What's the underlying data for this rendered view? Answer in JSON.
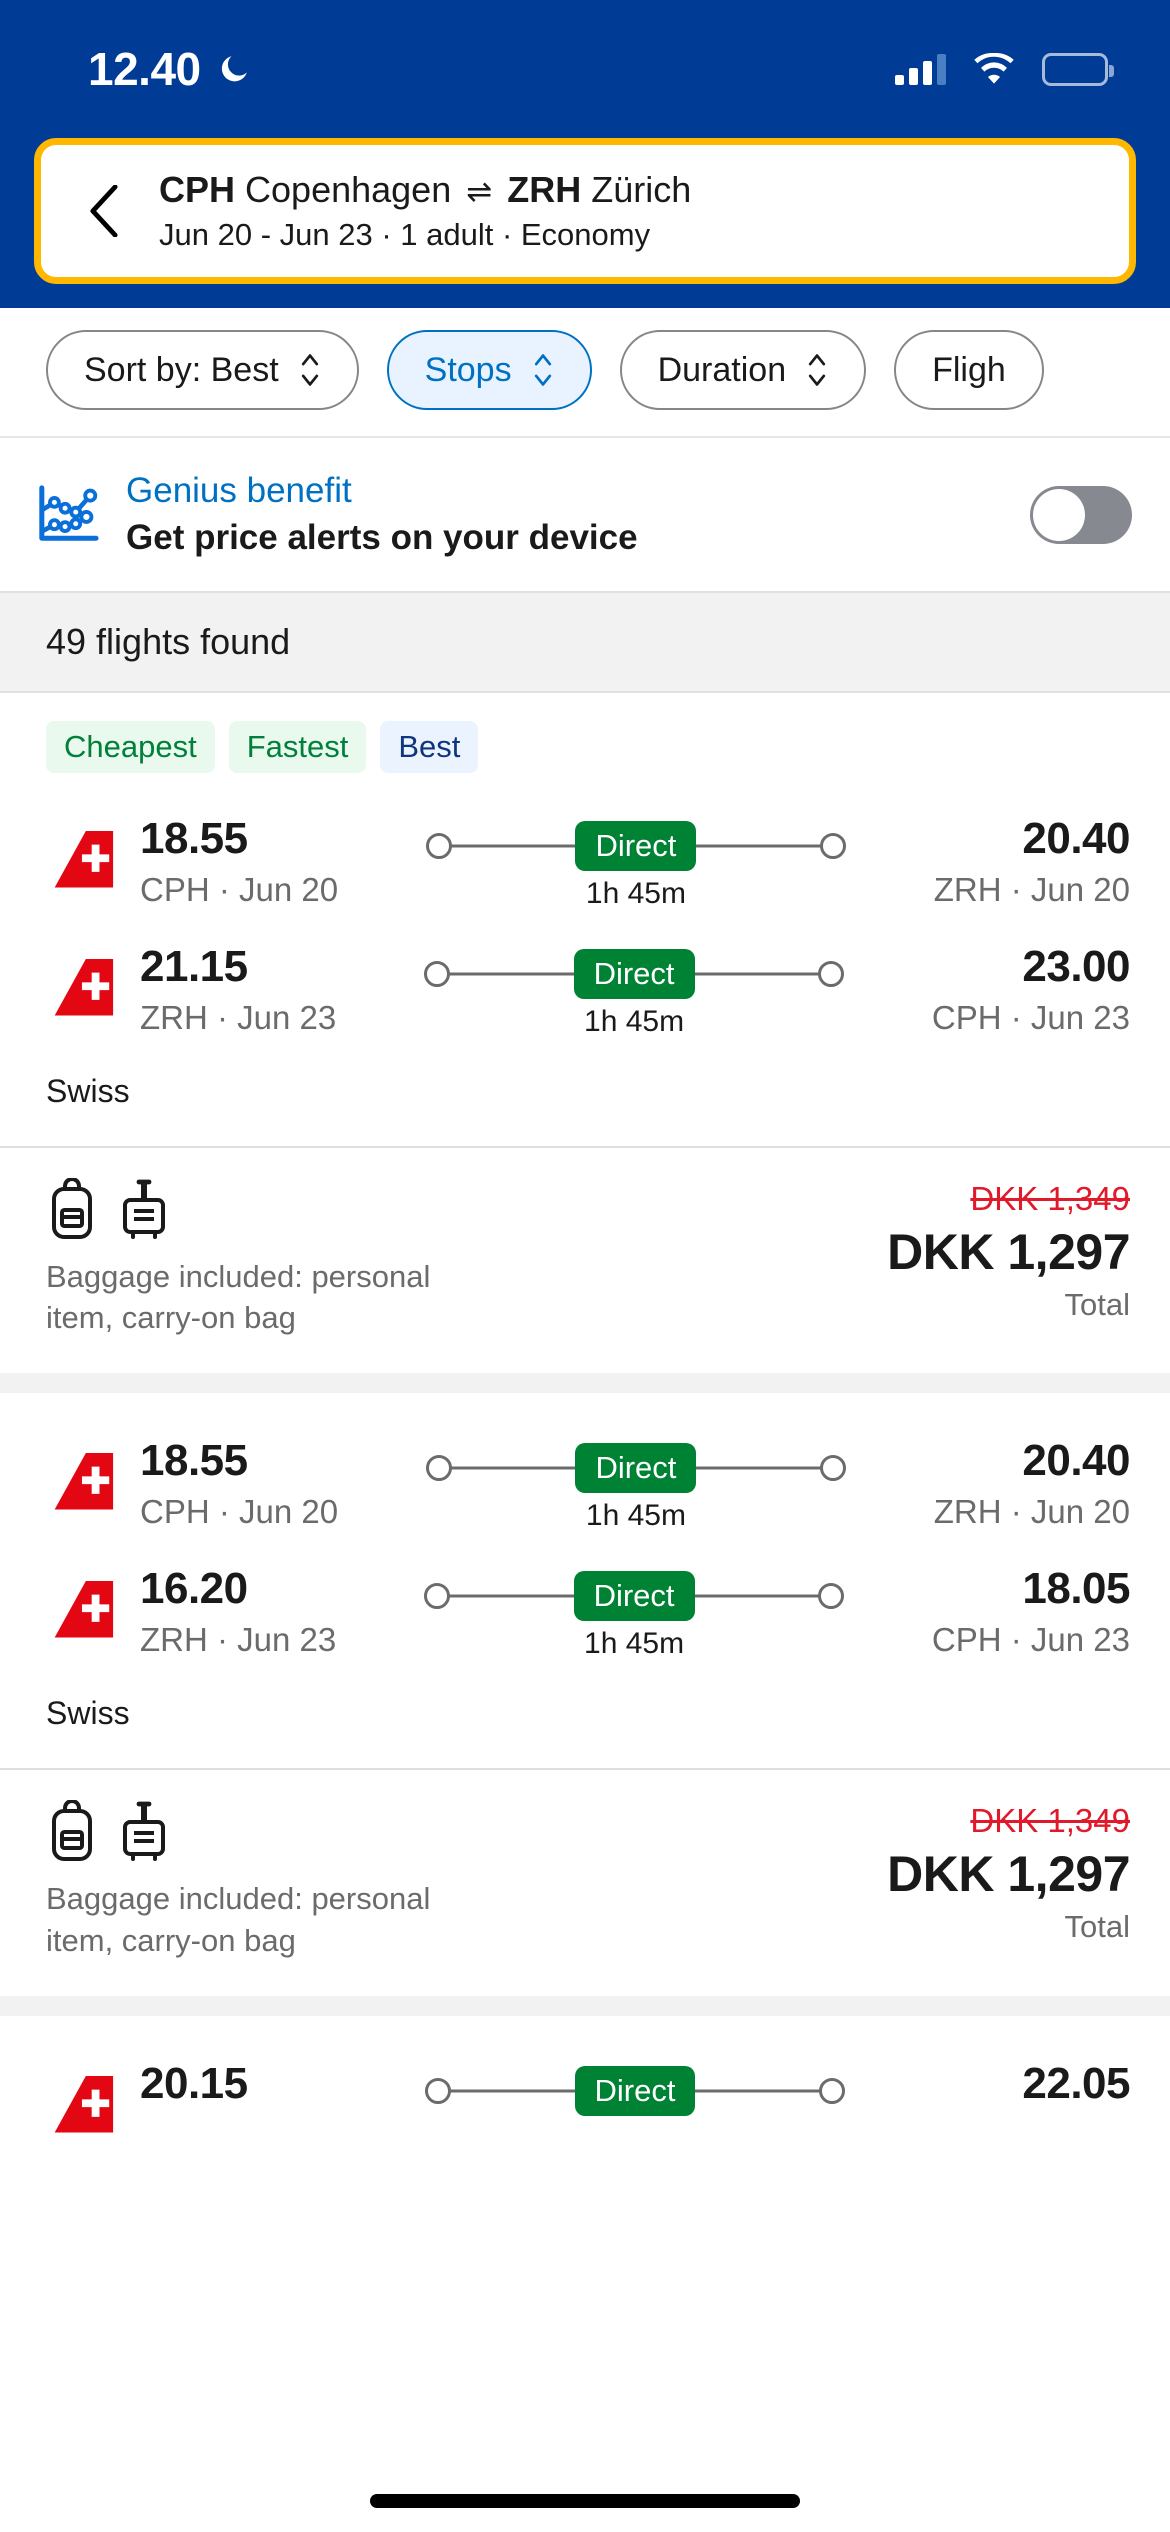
{
  "status_bar": {
    "time": "12.40",
    "moon_icon": "crescent-moon-icon",
    "signal_icon": "cellular-signal-icon",
    "wifi_icon": "wifi-icon",
    "battery_icon": "battery-icon",
    "battery_color": "#ffd700"
  },
  "header": {
    "back_icon": "chevron-left-icon",
    "origin_code": "CPH",
    "origin_city": "Copenhagen",
    "swap_icon": "swap-arrows-icon",
    "destination_code": "ZRH",
    "destination_city": "Zürich",
    "trip_meta": "Jun 20 - Jun 23 · 1 adult · Economy",
    "accent_border_color": "#ffb700",
    "background_color": "#003b95"
  },
  "filters": [
    {
      "label": "Sort by: Best",
      "icon": "up-down-chevron-icon",
      "active": false
    },
    {
      "label": "Stops",
      "icon": "up-down-chevron-icon",
      "active": true
    },
    {
      "label": "Duration",
      "icon": "up-down-chevron-icon",
      "active": false
    },
    {
      "label": "Fligh",
      "icon": "up-down-chevron-icon",
      "active": false
    }
  ],
  "genius_banner": {
    "icon": "price-chart-icon",
    "label": "Genius benefit",
    "title": "Get price alerts on your device",
    "toggle_state": "off",
    "link_color": "#0071c2"
  },
  "results": {
    "count_text": "49 flights found"
  },
  "flight_cards": [
    {
      "badges": [
        {
          "label": "Cheapest",
          "tone": "green"
        },
        {
          "label": "Fastest",
          "tone": "green"
        },
        {
          "label": "Best",
          "tone": "blue"
        }
      ],
      "legs": [
        {
          "airline_logo": "swiss-tail-logo",
          "depart_time": "18.55",
          "depart_place": "CPH · Jun 20",
          "stops_label": "Direct",
          "duration": "1h 45m",
          "arrive_time": "20.40",
          "arrive_place": "ZRH · Jun 20"
        },
        {
          "airline_logo": "swiss-tail-logo",
          "depart_time": "21.15",
          "depart_place": "ZRH · Jun 23",
          "stops_label": "Direct",
          "duration": "1h 45m",
          "arrive_time": "23.00",
          "arrive_place": "CPH · Jun 23"
        }
      ],
      "airline_name": "Swiss",
      "baggage_icons": [
        "backpack-icon",
        "carry-on-bag-icon"
      ],
      "baggage_text": "Baggage included: personal item, carry-on bag",
      "price_old": "DKK 1,349",
      "price_new": "DKK 1,297",
      "price_label": "Total"
    },
    {
      "badges": [],
      "legs": [
        {
          "airline_logo": "swiss-tail-logo",
          "depart_time": "18.55",
          "depart_place": "CPH · Jun 20",
          "stops_label": "Direct",
          "duration": "1h 45m",
          "arrive_time": "20.40",
          "arrive_place": "ZRH · Jun 20"
        },
        {
          "airline_logo": "swiss-tail-logo",
          "depart_time": "16.20",
          "depart_place": "ZRH · Jun 23",
          "stops_label": "Direct",
          "duration": "1h 45m",
          "arrive_time": "18.05",
          "arrive_place": "CPH · Jun 23"
        }
      ],
      "airline_name": "Swiss",
      "baggage_icons": [
        "backpack-icon",
        "carry-on-bag-icon"
      ],
      "baggage_text": "Baggage included: personal item, carry-on bag",
      "price_old": "DKK 1,349",
      "price_new": "DKK 1,297",
      "price_label": "Total"
    },
    {
      "badges": [],
      "legs": [
        {
          "airline_logo": "swiss-tail-logo",
          "depart_time": "20.15",
          "depart_place": "",
          "stops_label": "Direct",
          "duration": "",
          "arrive_time": "22.05",
          "arrive_place": ""
        }
      ],
      "airline_name": "",
      "baggage_icons": [],
      "baggage_text": "",
      "price_old": "",
      "price_new": "",
      "price_label": ""
    }
  ],
  "home_indicator": "home-indicator"
}
